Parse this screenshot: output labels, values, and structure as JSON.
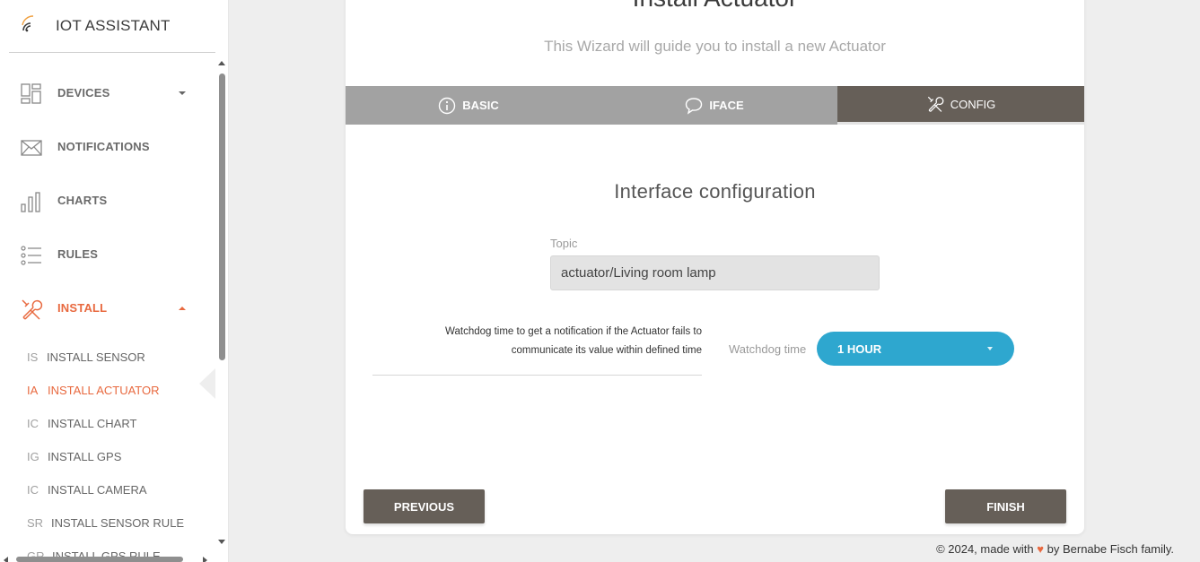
{
  "app": {
    "title": "IOT ASSISTANT"
  },
  "sidebar": {
    "items": [
      {
        "label": "DEVICES",
        "icon": "devices-grid-icon",
        "expandable": true
      },
      {
        "label": "NOTIFICATIONS",
        "icon": "envelope-icon"
      },
      {
        "label": "CHARTS",
        "icon": "bar-chart-icon"
      },
      {
        "label": "RULES",
        "icon": "list-icon"
      },
      {
        "label": "INSTALL",
        "icon": "tools-icon",
        "expanded": true,
        "active": true
      }
    ],
    "install_sub": [
      {
        "abbr": "IS",
        "label": "INSTALL SENSOR"
      },
      {
        "abbr": "IA",
        "label": "INSTALL ACTUATOR",
        "active": true
      },
      {
        "abbr": "IC",
        "label": "INSTALL CHART"
      },
      {
        "abbr": "IG",
        "label": "INSTALL GPS"
      },
      {
        "abbr": "IC",
        "label": "INSTALL CAMERA"
      },
      {
        "abbr": "SR",
        "label": "INSTALL SENSOR RULE"
      },
      {
        "abbr": "GR",
        "label": "INSTALL GPS RULE"
      }
    ]
  },
  "wizard": {
    "title": "Install Actuator",
    "subtitle": "This Wizard will guide you to install a new Actuator",
    "tabs": [
      {
        "label": "BASIC",
        "icon": "info-icon"
      },
      {
        "label": "IFACE",
        "icon": "chat-bubble-icon"
      },
      {
        "label": "CONFIG",
        "icon": "tools-icon",
        "active": true
      }
    ],
    "section_title": "Interface configuration",
    "topic": {
      "label": "Topic",
      "value": "actuator/Living room lamp"
    },
    "watchdog": {
      "help_line1": "Watchdog time to get a notification if the Actuator fails to",
      "help_line2": "communicate its value within defined time",
      "label": "Watchdog time",
      "value": "1 HOUR"
    },
    "previous_label": "PREVIOUS",
    "finish_label": "FINISH"
  },
  "footer": {
    "prefix": "© 2024, made with",
    "heart": "♥",
    "suffix": "by Bernabe Fisch family."
  },
  "colors": {
    "accent": "#e8693f",
    "primary_dark": "#665f58",
    "select_blue": "#2ea7cf",
    "tab_inactive": "#a2a2a2"
  }
}
